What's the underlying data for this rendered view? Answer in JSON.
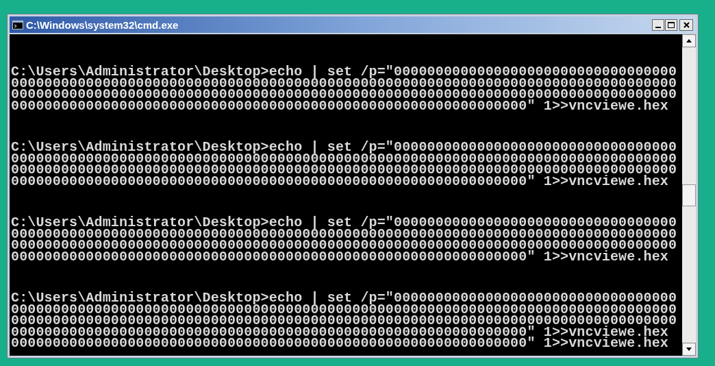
{
  "window": {
    "title": "C:\\Windows\\system32\\cmd.exe"
  },
  "console": {
    "blocks": [
      {
        "lines": [
          "C:\\Users\\Administrator\\Desktop>echo | set /p=\"0000000000000000000000000000000000",
          "00000000000000000000000000000000000000000000000000000000000000000000000000000000",
          "00000000000000000000000000000000000000000000000000000000000000000000000000000000",
          "00000000000000000000000000000000000000000000000000000000000000\" 1>>vncviewe.hex"
        ]
      },
      {
        "lines": [
          "C:\\Users\\Administrator\\Desktop>echo | set /p=\"0000000000000000000000000000000000",
          "00000000000000000000000000000000000000000000000000000000000000000000000000000000",
          "00000000000000000000000000000000000000000000000000000000000000000000000000000000",
          "00000000000000000000000000000000000000000000000000000000000000\" 1>>vncviewe.hex"
        ]
      },
      {
        "lines": [
          "C:\\Users\\Administrator\\Desktop>echo | set /p=\"0000000000000000000000000000000000",
          "00000000000000000000000000000000000000000000000000000000000000000000000000000000",
          "00000000000000000000000000000000000000000000000000000000000000000000000000000000",
          "00000000000000000000000000000000000000000000000000000000000000\" 1>>vncviewe.hex"
        ]
      },
      {
        "lines": [
          "C:\\Users\\Administrator\\Desktop>echo | set /p=\"0000000000000000000000000000000000",
          "00000000000000000000000000000000000000000000000000000000000000000000000000000000",
          "00000000000000000000000000000000000000000000000000000000000000000000000000000000",
          "00000000000000000000000000000000000000000000000000000000000000\" 1>>vncviewe.hex",
          "00000000000000000000000000000000000000000000000000000000000000\" 1>>vncviewe.hex"
        ]
      }
    ]
  }
}
